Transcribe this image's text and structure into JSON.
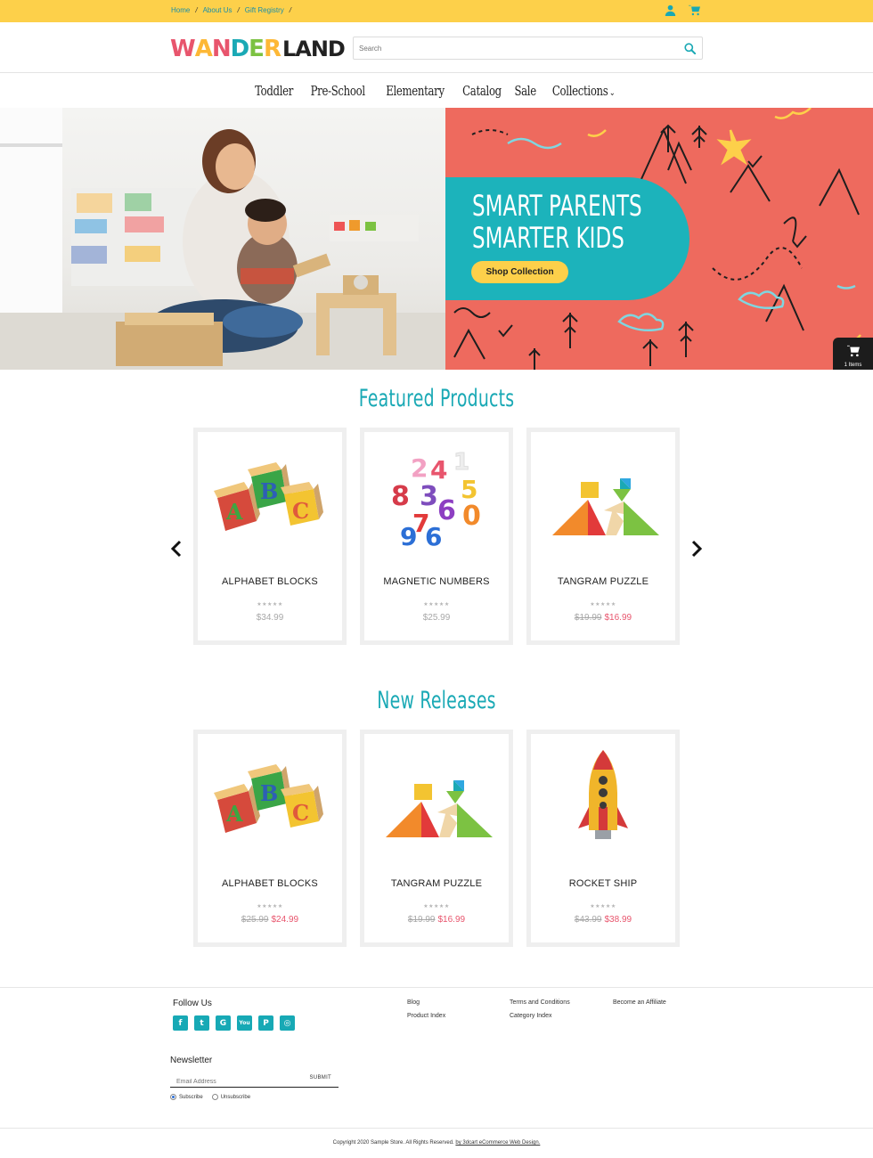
{
  "topbar": {
    "breadcrumbs": [
      "Home",
      "About Us",
      "Gift Registry"
    ],
    "separator": "/",
    "icons": [
      "user-icon",
      "cart-icon"
    ]
  },
  "header": {
    "logo_letters": [
      "W",
      "A",
      "N",
      "D",
      "E",
      "R",
      "LAND"
    ],
    "logo_colors": [
      "#e8556d",
      "#fdd04a",
      "#e8556d",
      "#1aa9b5",
      "#7cc242",
      "#fdd04a",
      "#222222"
    ],
    "search_placeholder": "Search"
  },
  "nav": {
    "items": [
      "Toddler",
      "Pre-School",
      "Elementary",
      "Catalog",
      "Sale",
      "Collections"
    ]
  },
  "hero": {
    "title_line1": "Smart Parents",
    "title_line2": "Smarter Kids",
    "button_label": "Shop Collection",
    "cart_count": "1 Items",
    "accent": "#1cb3bb",
    "background": "#ee6a5e"
  },
  "featured": {
    "title": "Featured Products",
    "products": [
      {
        "name": "ALPHABET BLOCKS",
        "stars": "★★★★★",
        "price": "$34.99"
      },
      {
        "name": "MAGNETIC NUMBERS",
        "stars": "★★★★★",
        "price": "$25.99"
      },
      {
        "name": "TANGRAM PUZZLE",
        "stars": "★★★★★",
        "old_price": "$19.99",
        "sale_price": "$16.99"
      }
    ]
  },
  "new_releases": {
    "title": "New Releases",
    "products": [
      {
        "name": "ALPHABET BLOCKS",
        "stars": "★★★★★",
        "old_price": "$25.99",
        "sale_price": "$24.99"
      },
      {
        "name": "TANGRAM PUZZLE",
        "stars": "★★★★★",
        "old_price": "$19.99",
        "sale_price": "$16.99"
      },
      {
        "name": "ROCKET SHIP",
        "stars": "★★★★★",
        "old_price": "$43.99",
        "sale_price": "$38.99"
      }
    ]
  },
  "footer": {
    "follow_label": "Follow Us",
    "social": [
      "f",
      "t",
      "G",
      "You",
      "P",
      "◎"
    ],
    "social_icons": [
      "facebook-icon",
      "twitter-icon",
      "google-icon",
      "youtube-icon",
      "pinterest-icon",
      "instagram-icon"
    ],
    "links_col1": [
      "Blog",
      "Product Index"
    ],
    "links_col2": [
      "Terms and Conditions",
      "Category Index"
    ],
    "links_col3": [
      "Become an Affiliate"
    ],
    "newsletter_title": "Newsletter",
    "email_placeholder": "Email Address",
    "submit_label": "SUBMIT",
    "subscribe_label": "Subscribe",
    "unsubscribe_label": "Unsubscribe",
    "copyright": "Copyright 2020 Sample Store. All Rights Reserved.",
    "credit": "by 3dcart eCommerce Web Design."
  }
}
